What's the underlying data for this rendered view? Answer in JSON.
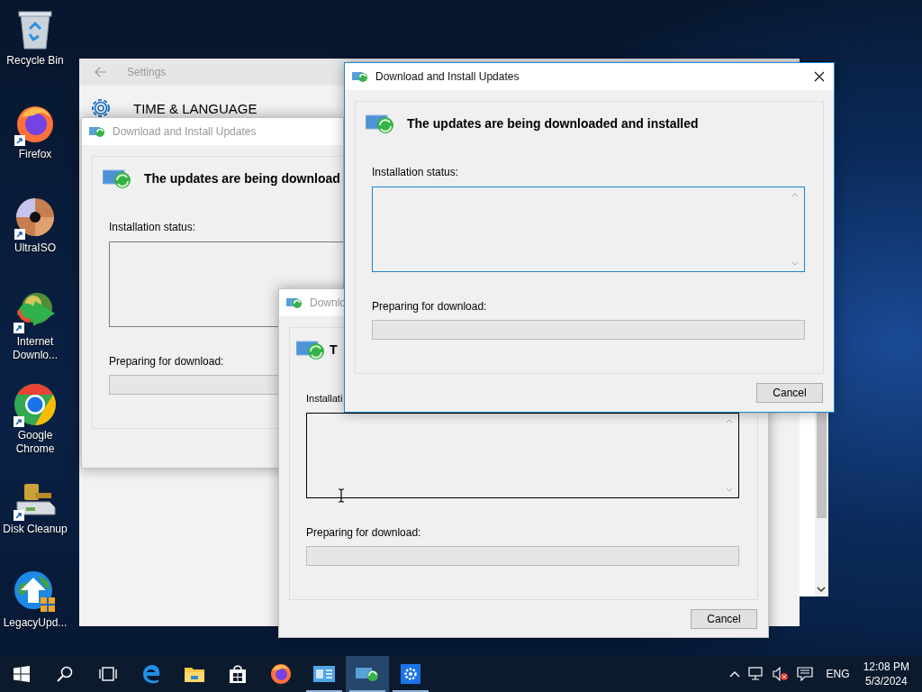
{
  "desktop_icons": [
    {
      "kind": "recycle-bin",
      "label": "Recycle Bin",
      "shortcut": false
    },
    {
      "kind": "firefox",
      "label": "Firefox",
      "shortcut": true
    },
    {
      "kind": "disc",
      "label": "UltraISO",
      "shortcut": true
    },
    {
      "kind": "globe-arrow",
      "label": "Internet Downlo...",
      "shortcut": true
    },
    {
      "kind": "chrome",
      "label": "Google Chrome",
      "shortcut": true
    },
    {
      "kind": "cleanup",
      "label": "Disk Cleanup",
      "shortcut": true
    },
    {
      "kind": "globe-update",
      "label": "LegacyUpd...",
      "shortcut": false
    }
  ],
  "settings_window": {
    "title": "Settings",
    "header": "TIME & LANGUAGE"
  },
  "dialogs": [
    {
      "title": "Download and Install Updates",
      "active": false,
      "close_button": false,
      "heading": "The updates are being download",
      "status_label": "Installation status:",
      "status_box": {
        "focused": false,
        "hovered": false,
        "scrollbar": false
      },
      "progress_label": "Preparing for download:"
    },
    {
      "title": "Downlo",
      "active": false,
      "close_button": false,
      "heading": "T",
      "status_label": "Installati",
      "status_box": {
        "focused": false,
        "hovered": true,
        "scrollbar": true
      },
      "progress_label": "Preparing for download:",
      "cancel": "Cancel"
    },
    {
      "title": "Download and Install Updates",
      "active": true,
      "close_button": true,
      "heading": "The updates are being downloaded and installed",
      "status_label": "Installation status:",
      "status_box": {
        "focused": true,
        "hovered": false,
        "scrollbar": true
      },
      "progress_label": "Preparing for download:",
      "cancel": "Cancel"
    }
  ],
  "taskbar": {
    "items": [
      {
        "kind": "start",
        "selected": false,
        "running": false
      },
      {
        "kind": "search",
        "selected": false,
        "running": false
      },
      {
        "kind": "task-view",
        "selected": false,
        "running": false
      },
      {
        "kind": "edge",
        "selected": false,
        "running": false
      },
      {
        "kind": "explorer",
        "selected": false,
        "running": false
      },
      {
        "kind": "store",
        "selected": false,
        "running": false
      },
      {
        "kind": "firefox",
        "selected": false,
        "running": false
      },
      {
        "kind": "app",
        "selected": false,
        "running": true
      },
      {
        "kind": "updates",
        "selected": true,
        "running": true
      },
      {
        "kind": "settings",
        "selected": false,
        "running": true
      }
    ],
    "language": "ENG",
    "time": "12:08 PM",
    "date": "5/3/2024"
  }
}
